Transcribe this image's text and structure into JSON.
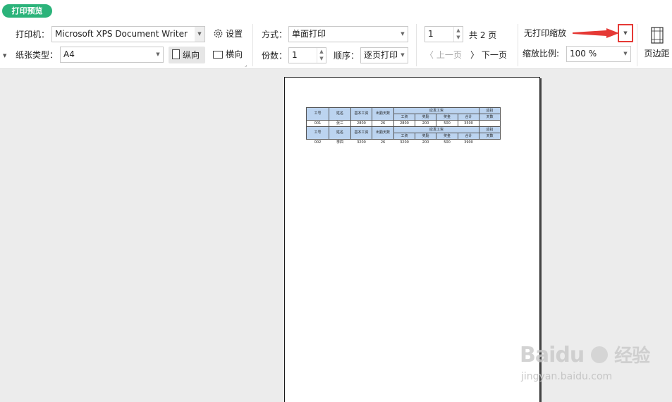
{
  "toolbar": {
    "title": "打印预览",
    "printer_label": "打印机：",
    "printer_value": "Microsoft XPS Document Writer",
    "settings_label": "设置",
    "paper_label": "纸张类型：",
    "paper_value": "A4",
    "portrait_label": "纵向",
    "landscape_label": "横向",
    "mode_label": "方式：",
    "mode_value": "单面打印",
    "copies_label": "份数：",
    "copies_value": "1",
    "order_label": "顺序：",
    "order_value": "逐页打印",
    "page_value": "1",
    "total_pages": "共 2 页",
    "prev_label": "上一页",
    "next_label": "下一页",
    "scale_mode_value": "无打印缩放",
    "zoom_label": "缩放比例:",
    "zoom_value": "100 %",
    "margins_label": "页边距"
  },
  "sheet": {
    "headers": [
      "工号",
      "姓名",
      "基本工资",
      "出勤天数",
      "应发工资",
      "应扣"
    ],
    "subheaders": [
      "工资",
      "奖励",
      "奖金",
      "合计",
      "天数"
    ],
    "rows": [
      [
        "001",
        "张三",
        "2800",
        "26",
        "2800",
        "200",
        "500",
        "3500",
        ""
      ],
      [
        "002",
        "李四",
        "3200",
        "26",
        "3200",
        "200",
        "500",
        "3900",
        ""
      ]
    ]
  },
  "watermark": {
    "brand": "Baidu",
    "brand_cn": "经验",
    "url": "jingyan.baidu.com"
  },
  "colors": {
    "accent": "#2bb37a",
    "highlight": "#e53935",
    "header_fill": "#bcd4f0"
  }
}
